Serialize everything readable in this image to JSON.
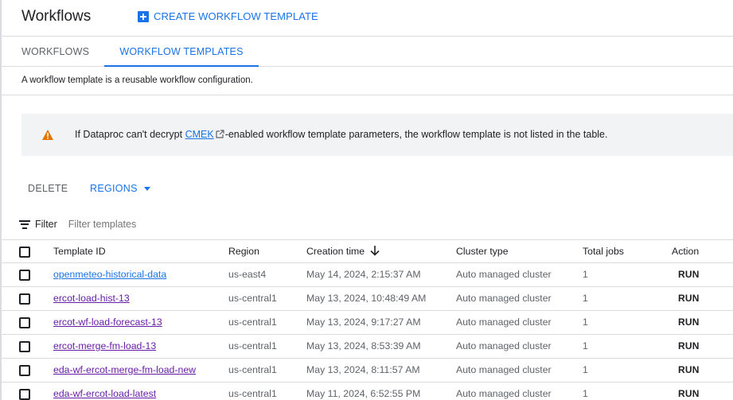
{
  "header": {
    "title": "Workflows",
    "create_label": "CREATE WORKFLOW TEMPLATE"
  },
  "tabs": [
    {
      "label": "WORKFLOWS",
      "active": false
    },
    {
      "label": "WORKFLOW TEMPLATES",
      "active": true
    }
  ],
  "description": "A workflow template is a reusable workflow configuration.",
  "banner": {
    "prefix": "If Dataproc can't decrypt ",
    "link": "CMEK",
    "suffix": "-enabled workflow template parameters, the workflow template is not listed in the table."
  },
  "toolbar": {
    "delete_label": "DELETE",
    "regions_label": "REGIONS"
  },
  "filter": {
    "label": "Filter",
    "placeholder": "Filter templates"
  },
  "table": {
    "headers": {
      "id": "Template ID",
      "region": "Region",
      "time": "Creation time",
      "cluster": "Cluster type",
      "jobs": "Total jobs",
      "action": "Action"
    },
    "rows": [
      {
        "id": "openmeteo-historical-data",
        "region": "us-east4",
        "time": "May 14, 2024, 2:15:37 AM",
        "cluster": "Auto managed cluster",
        "jobs": "1",
        "action": "RUN"
      },
      {
        "id": "ercot-load-hist-13",
        "region": "us-central1",
        "time": "May 13, 2024, 10:48:49 AM",
        "cluster": "Auto managed cluster",
        "jobs": "1",
        "action": "RUN"
      },
      {
        "id": "ercot-wf-load-forecast-13",
        "region": "us-central1",
        "time": "May 13, 2024, 9:17:27 AM",
        "cluster": "Auto managed cluster",
        "jobs": "1",
        "action": "RUN"
      },
      {
        "id": "ercot-merge-fm-load-13",
        "region": "us-central1",
        "time": "May 13, 2024, 8:53:39 AM",
        "cluster": "Auto managed cluster",
        "jobs": "1",
        "action": "RUN"
      },
      {
        "id": "eda-wf-ercot-merge-fm-load-new",
        "region": "us-central1",
        "time": "May 13, 2024, 8:11:57 AM",
        "cluster": "Auto managed cluster",
        "jobs": "1",
        "action": "RUN"
      },
      {
        "id": "eda-wf-ercot-load-latest",
        "region": "us-central1",
        "time": "May 11, 2024, 6:52:55 PM",
        "cluster": "Auto managed cluster",
        "jobs": "1",
        "action": "RUN"
      }
    ]
  },
  "colors": {
    "accent": "#1a73e8",
    "visited_link": "#681da8",
    "warning": "#e37400"
  }
}
